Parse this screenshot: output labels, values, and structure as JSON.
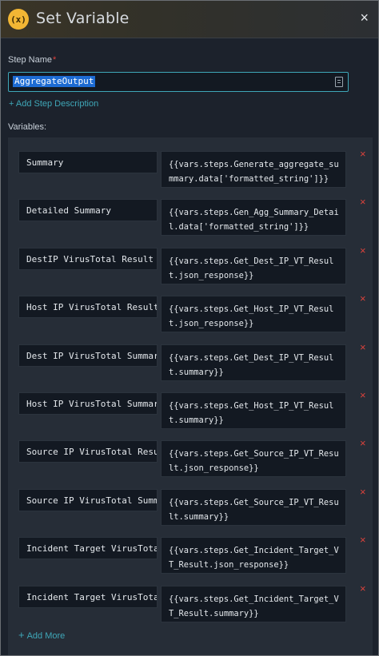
{
  "header": {
    "badge_text": "(x)",
    "title": "Set Variable",
    "close_symbol": "×"
  },
  "step_name": {
    "label": "Step Name",
    "required_mark": "*",
    "value": "AggregateOutput"
  },
  "add_step_description": "+ Add Step Description",
  "variables_label": "Variables:",
  "variables": [
    {
      "name": "Summary",
      "value": "{{vars.steps.Generate_aggregate_summary.data['formatted_string']}}"
    },
    {
      "name": "Detailed Summary",
      "value": "{{vars.steps.Gen_Agg_Summary_Detail.data['formatted_string']}}"
    },
    {
      "name": "DestIP VirusTotal Result",
      "value": "{{vars.steps.Get_Dest_IP_VT_Result.json_response}}"
    },
    {
      "name": "Host IP VirusTotal Result",
      "value": "{{vars.steps.Get_Host_IP_VT_Result.json_response}}"
    },
    {
      "name": "Dest IP VirusTotal Summar",
      "value": "{{vars.steps.Get_Dest_IP_VT_Result.summary}}"
    },
    {
      "name": "Host IP VirusTotal Summar",
      "value": "{{vars.steps.Get_Host_IP_VT_Result.summary}}"
    },
    {
      "name": "Source IP VirusTotal Resu",
      "value": "{{vars.steps.Get_Source_IP_VT_Result.json_response}}"
    },
    {
      "name": "Source IP VirusTotal Summ",
      "value": "{{vars.steps.Get_Source_IP_VT_Result.summary}}"
    },
    {
      "name": "Incident Target VirusTota",
      "value": "{{vars.steps.Get_Incident_Target_VT_Result.json_response}}"
    },
    {
      "name": "Incident Target VirusTota",
      "value": "{{vars.steps.Get_Incident_Target_VT_Result.summary}}"
    }
  ],
  "remove_symbol": "×",
  "add_more": {
    "plus": "+",
    "label": "Add More"
  },
  "colors": {
    "accent": "#3fa7b8",
    "badge": "#f2b634",
    "remove": "#d9423b",
    "selection": "#1d6bd3"
  },
  "icons": {
    "badge": "variable-icon",
    "close": "close-icon",
    "field": "field-options-icon",
    "remove": "remove-icon",
    "add": "plus-icon"
  }
}
